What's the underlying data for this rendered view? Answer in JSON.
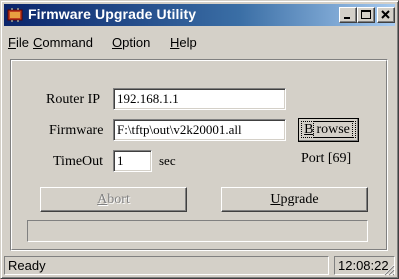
{
  "window": {
    "title": "Firmware Upgrade Utility",
    "icons": {
      "app": "chip-icon",
      "minimize": "minimize-icon",
      "maximize": "maximize-icon",
      "close": "close-icon"
    }
  },
  "menu": {
    "items": [
      {
        "label": "File",
        "mnemonic": "F",
        "rest": "ile"
      },
      {
        "label": "Command",
        "mnemonic": "C",
        "rest": "ommand"
      },
      {
        "label": "Option",
        "mnemonic": "O",
        "rest": "ption"
      },
      {
        "label": "Help",
        "mnemonic": "H",
        "rest": "elp"
      }
    ]
  },
  "form": {
    "router_ip_label": "Router IP",
    "router_ip_value": "192.168.1.1",
    "firmware_label": "Firmware",
    "firmware_value": "F:\\tftp\\out\\v2k20001.all",
    "browse_mnemonic": "B",
    "browse_rest": "rowse",
    "timeout_label": "TimeOut",
    "timeout_value": "1",
    "timeout_unit": "sec",
    "port_text": "Port  [69]"
  },
  "actions": {
    "abort_mnemonic": "A",
    "abort_rest": "bort",
    "abort_enabled": false,
    "upgrade_mnemonic": "U",
    "upgrade_rest": "pgrade",
    "upgrade_enabled": true
  },
  "progress": {
    "fraction": 0
  },
  "status": {
    "message": "Ready",
    "time": "12:08:22"
  },
  "colors": {
    "title_start": "#0a246a",
    "title_end": "#a6caf0",
    "face": "#d4d0c8"
  }
}
